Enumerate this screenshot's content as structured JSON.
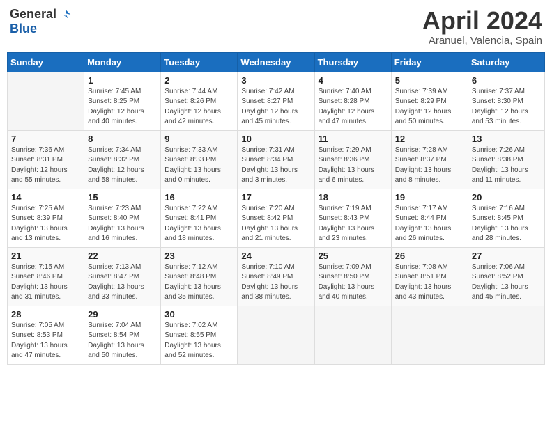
{
  "header": {
    "logo_general": "General",
    "logo_blue": "Blue",
    "month_title": "April 2024",
    "location": "Aranuel, Valencia, Spain"
  },
  "weekdays": [
    "Sunday",
    "Monday",
    "Tuesday",
    "Wednesday",
    "Thursday",
    "Friday",
    "Saturday"
  ],
  "weeks": [
    [
      {
        "day": "",
        "info": ""
      },
      {
        "day": "1",
        "info": "Sunrise: 7:45 AM\nSunset: 8:25 PM\nDaylight: 12 hours\nand 40 minutes."
      },
      {
        "day": "2",
        "info": "Sunrise: 7:44 AM\nSunset: 8:26 PM\nDaylight: 12 hours\nand 42 minutes."
      },
      {
        "day": "3",
        "info": "Sunrise: 7:42 AM\nSunset: 8:27 PM\nDaylight: 12 hours\nand 45 minutes."
      },
      {
        "day": "4",
        "info": "Sunrise: 7:40 AM\nSunset: 8:28 PM\nDaylight: 12 hours\nand 47 minutes."
      },
      {
        "day": "5",
        "info": "Sunrise: 7:39 AM\nSunset: 8:29 PM\nDaylight: 12 hours\nand 50 minutes."
      },
      {
        "day": "6",
        "info": "Sunrise: 7:37 AM\nSunset: 8:30 PM\nDaylight: 12 hours\nand 53 minutes."
      }
    ],
    [
      {
        "day": "7",
        "info": "Sunrise: 7:36 AM\nSunset: 8:31 PM\nDaylight: 12 hours\nand 55 minutes."
      },
      {
        "day": "8",
        "info": "Sunrise: 7:34 AM\nSunset: 8:32 PM\nDaylight: 12 hours\nand 58 minutes."
      },
      {
        "day": "9",
        "info": "Sunrise: 7:33 AM\nSunset: 8:33 PM\nDaylight: 13 hours\nand 0 minutes."
      },
      {
        "day": "10",
        "info": "Sunrise: 7:31 AM\nSunset: 8:34 PM\nDaylight: 13 hours\nand 3 minutes."
      },
      {
        "day": "11",
        "info": "Sunrise: 7:29 AM\nSunset: 8:36 PM\nDaylight: 13 hours\nand 6 minutes."
      },
      {
        "day": "12",
        "info": "Sunrise: 7:28 AM\nSunset: 8:37 PM\nDaylight: 13 hours\nand 8 minutes."
      },
      {
        "day": "13",
        "info": "Sunrise: 7:26 AM\nSunset: 8:38 PM\nDaylight: 13 hours\nand 11 minutes."
      }
    ],
    [
      {
        "day": "14",
        "info": "Sunrise: 7:25 AM\nSunset: 8:39 PM\nDaylight: 13 hours\nand 13 minutes."
      },
      {
        "day": "15",
        "info": "Sunrise: 7:23 AM\nSunset: 8:40 PM\nDaylight: 13 hours\nand 16 minutes."
      },
      {
        "day": "16",
        "info": "Sunrise: 7:22 AM\nSunset: 8:41 PM\nDaylight: 13 hours\nand 18 minutes."
      },
      {
        "day": "17",
        "info": "Sunrise: 7:20 AM\nSunset: 8:42 PM\nDaylight: 13 hours\nand 21 minutes."
      },
      {
        "day": "18",
        "info": "Sunrise: 7:19 AM\nSunset: 8:43 PM\nDaylight: 13 hours\nand 23 minutes."
      },
      {
        "day": "19",
        "info": "Sunrise: 7:17 AM\nSunset: 8:44 PM\nDaylight: 13 hours\nand 26 minutes."
      },
      {
        "day": "20",
        "info": "Sunrise: 7:16 AM\nSunset: 8:45 PM\nDaylight: 13 hours\nand 28 minutes."
      }
    ],
    [
      {
        "day": "21",
        "info": "Sunrise: 7:15 AM\nSunset: 8:46 PM\nDaylight: 13 hours\nand 31 minutes."
      },
      {
        "day": "22",
        "info": "Sunrise: 7:13 AM\nSunset: 8:47 PM\nDaylight: 13 hours\nand 33 minutes."
      },
      {
        "day": "23",
        "info": "Sunrise: 7:12 AM\nSunset: 8:48 PM\nDaylight: 13 hours\nand 35 minutes."
      },
      {
        "day": "24",
        "info": "Sunrise: 7:10 AM\nSunset: 8:49 PM\nDaylight: 13 hours\nand 38 minutes."
      },
      {
        "day": "25",
        "info": "Sunrise: 7:09 AM\nSunset: 8:50 PM\nDaylight: 13 hours\nand 40 minutes."
      },
      {
        "day": "26",
        "info": "Sunrise: 7:08 AM\nSunset: 8:51 PM\nDaylight: 13 hours\nand 43 minutes."
      },
      {
        "day": "27",
        "info": "Sunrise: 7:06 AM\nSunset: 8:52 PM\nDaylight: 13 hours\nand 45 minutes."
      }
    ],
    [
      {
        "day": "28",
        "info": "Sunrise: 7:05 AM\nSunset: 8:53 PM\nDaylight: 13 hours\nand 47 minutes."
      },
      {
        "day": "29",
        "info": "Sunrise: 7:04 AM\nSunset: 8:54 PM\nDaylight: 13 hours\nand 50 minutes."
      },
      {
        "day": "30",
        "info": "Sunrise: 7:02 AM\nSunset: 8:55 PM\nDaylight: 13 hours\nand 52 minutes."
      },
      {
        "day": "",
        "info": ""
      },
      {
        "day": "",
        "info": ""
      },
      {
        "day": "",
        "info": ""
      },
      {
        "day": "",
        "info": ""
      }
    ]
  ]
}
